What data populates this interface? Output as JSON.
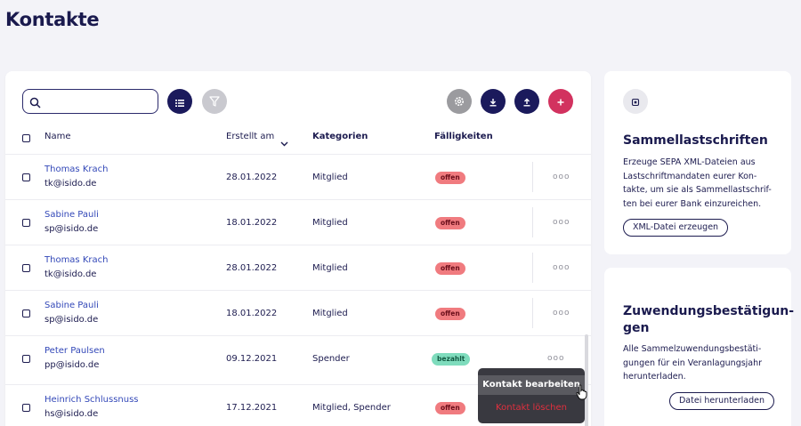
{
  "page": {
    "title": "Kontakte"
  },
  "toolbar": {
    "search_value": "",
    "search_placeholder": "",
    "icons": [
      "search-icon",
      "list-icon",
      "filter-icon",
      "settings-icon",
      "download-icon",
      "upload-icon",
      "plus-icon"
    ]
  },
  "table": {
    "headers": {
      "name": "Name",
      "created": "Erstellt am",
      "categories": "Kategorien",
      "due": "Fälligkeiten"
    },
    "rows": [
      {
        "name": "Thomas Krach",
        "email": "tk@isido.de",
        "date": "28.01.2022",
        "category": "Mitglied",
        "status": "offen"
      },
      {
        "name": "Sabine Pauli",
        "email": "sp@isido.de",
        "date": "18.01.2022",
        "category": "Mitglied",
        "status": "offen"
      },
      {
        "name": "Thomas Krach",
        "email": "tk@isido.de",
        "date": "28.01.2022",
        "category": "Mitglied",
        "status": "offen"
      },
      {
        "name": "Sabine Pauli",
        "email": "sp@isido.de",
        "date": "18.01.2022",
        "category": "Mitglied",
        "status": "offen"
      },
      {
        "name": "Peter Paulsen",
        "email": "pp@isido.de",
        "date": "09.12.2021",
        "category": "Spender",
        "status": "bezahlt"
      },
      {
        "name": "Heinrich Schlussnuss",
        "email": "hs@isido.de",
        "date": "17.12.2021",
        "category": "Mitglied, Spender",
        "status": "offen"
      }
    ],
    "row_menu_label": "ooo"
  },
  "context_menu": {
    "edit": "Kontakt bearbeiten",
    "delete": "Kontakt löschen"
  },
  "sepa_card": {
    "title": "Sammellastschriften",
    "text_lines": [
      "Erzeuge SEPA XML-Dateien aus",
      "Lastschriftmandaten eurer Kon-",
      "takte, um sie als Sammellastschrif-",
      "ten bei eurer Bank einzureichen."
    ],
    "button": "XML-Datei erzeugen"
  },
  "donation_card": {
    "title_lines": [
      "Zuwendungsbestätigun-",
      "gen"
    ],
    "text_lines": [
      "Alle Sammelzuwendungsbestäti-",
      "gungen für ein Veranlagungsjahr",
      "herunterladen."
    ],
    "button": "Datei herunterladen"
  },
  "colors": {
    "primary": "#1b1a5c",
    "accent": "#d2325f",
    "open": "#f07b7f",
    "paid": "#7fdcbd",
    "link": "#3348b8"
  }
}
